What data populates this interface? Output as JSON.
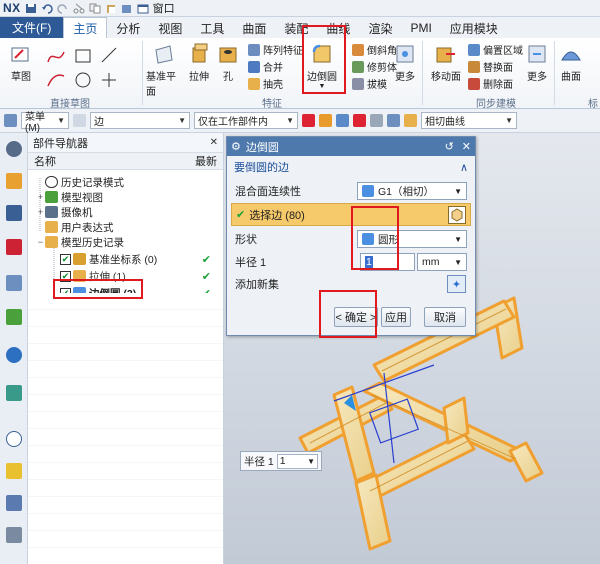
{
  "app": {
    "logo": "NX",
    "window_menu": "窗口"
  },
  "menu_tabs": [
    {
      "label": "文件(F)",
      "kind": "file"
    },
    {
      "label": "主页",
      "kind": "active"
    },
    {
      "label": "分析",
      "kind": "normal"
    },
    {
      "label": "视图",
      "kind": "normal"
    },
    {
      "label": "工具",
      "kind": "normal"
    },
    {
      "label": "曲面",
      "kind": "normal"
    },
    {
      "label": "装配",
      "kind": "normal"
    },
    {
      "label": "曲线",
      "kind": "normal"
    },
    {
      "label": "渲染",
      "kind": "normal"
    },
    {
      "label": "PMI",
      "kind": "normal"
    },
    {
      "label": "应用模块",
      "kind": "normal"
    }
  ],
  "ribbon": {
    "sketch_button": "草图",
    "sketch_group": "直接草图",
    "datum_plane": "基准平面",
    "extrude": "拉伸",
    "hole": "孔",
    "pattern_feature": "阵列特征",
    "unite": "合并",
    "shell": "抽壳",
    "edge_blend": "边倒圆",
    "chamfer": "倒斜角",
    "trim_body": "修剪体",
    "draft": "拔模",
    "more1": "更多",
    "feature_group": "特征",
    "move_face": "移动面",
    "offset_region": "偏置区域",
    "replace_face": "替换面",
    "delete_face": "删除面",
    "more2": "更多",
    "surface": "曲面",
    "sync_group": "同步建模",
    "cut_label": "标"
  },
  "selection_bar": {
    "menu": "菜单(M)",
    "filter": "边",
    "scope": "仅在工作部件内",
    "curve_rule": "相切曲线"
  },
  "navigator": {
    "title": "部件导航器",
    "col_name": "名称",
    "col_latest": "最新",
    "items": [
      {
        "label": "历史记录模式",
        "level": 0
      },
      {
        "label": "模型视图",
        "level": 0
      },
      {
        "label": "摄像机",
        "level": 0
      },
      {
        "label": "用户表达式",
        "level": 0
      },
      {
        "label": "模型历史记录",
        "level": 0
      },
      {
        "label": "基准坐标系 (0)",
        "level": 1,
        "latest": "✔"
      },
      {
        "label": "拉伸 (1)",
        "level": 1,
        "latest": "✔"
      },
      {
        "label": "边倒圆 (2)",
        "level": 1,
        "latest": "✔"
      }
    ]
  },
  "dialog": {
    "title": "边倒圆",
    "section": "要倒圆的边",
    "continuity_label": "混合面连续性",
    "continuity_value": "G1（相切）",
    "select_edge": "选择边 (80)",
    "shape_label": "形状",
    "shape_value": "圆形",
    "radius_label": "半径 1",
    "radius_value": "1",
    "unit": "mm",
    "add_new_set": "添加新集",
    "ok": "< 确定 >",
    "apply": "应用",
    "cancel": "取消"
  },
  "radius_float": {
    "label": "半径 1",
    "value": "1"
  },
  "colors": {
    "accent": "#2d5a97",
    "dialog_title": "#4d79ac",
    "highlight": "#e0191e",
    "model_orange": "#f0a030",
    "model_fill": "#f3e2b4",
    "check_green": "#1aa33a"
  }
}
